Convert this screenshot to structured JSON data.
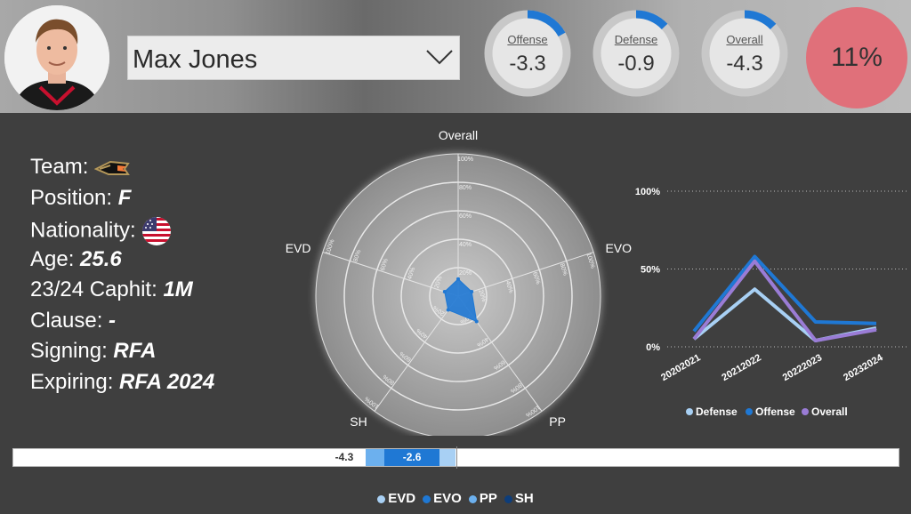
{
  "header": {
    "player_name": "Max Jones",
    "kpis": [
      {
        "label": "Offense",
        "value": "-3.3",
        "ring_fraction": 0.17
      },
      {
        "label": "Defense",
        "value": "-0.9",
        "ring_fraction": 0.13
      },
      {
        "label": "Overall",
        "value": "-4.3",
        "ring_fraction": 0.13
      }
    ],
    "percentile": "11%",
    "colors": {
      "ring_accent": "#1f78d4",
      "ring_track": "#c8c8c8",
      "percentile_bg": "#e0707a"
    }
  },
  "info": {
    "team_label": "Team:",
    "team_icon": "ducks-logo-icon",
    "position_label": "Position:",
    "position_value": "F",
    "nationality_label": "Nationality:",
    "nationality_icon": "usa-flag-icon",
    "age_label": "Age:",
    "age_value": "25.6",
    "caphit_label": "23/24 Caphit:",
    "caphit_value": "1M",
    "clause_label": "Clause:",
    "clause_value": "-",
    "signing_label": "Signing:",
    "signing_value": "RFA",
    "expiring_label": "Expiring:",
    "expiring_value": "RFA 2024"
  },
  "chart_data": [
    {
      "type": "radar",
      "axes": [
        "Overall",
        "EVO",
        "PP",
        "SH",
        "EVD"
      ],
      "ring_labels": [
        "100%",
        "80%",
        "60%",
        "40%",
        "20%"
      ],
      "values": [
        0.12,
        0.1,
        0.22,
        0.12,
        0.1
      ],
      "color": "#1f78d4"
    },
    {
      "type": "line",
      "categories": [
        "20202021",
        "20212022",
        "20222023",
        "20232024"
      ],
      "series": [
        {
          "name": "Defense",
          "values": [
            5,
            37,
            4,
            12
          ],
          "color": "#a8d0f4"
        },
        {
          "name": "Offense",
          "values": [
            10,
            58,
            16,
            15
          ],
          "color": "#1f78d4"
        },
        {
          "name": "Overall",
          "values": [
            5,
            55,
            4,
            11
          ],
          "color": "#9a7cd6"
        }
      ],
      "y_ticks": [
        "100%",
        "50%",
        "0%"
      ],
      "ylim": [
        0,
        100
      ],
      "legend_position": "bottom"
    },
    {
      "type": "bar",
      "orientation": "horizontal-stacked",
      "total_label": "-4.3",
      "segments": [
        {
          "name": "EVD",
          "value": -0.8,
          "color": "#a8d0f4"
        },
        {
          "name": "EVO",
          "value": -2.6,
          "color": "#1f78d4"
        },
        {
          "name": "PP",
          "value": -0.9,
          "color": "#6cb0ee"
        },
        {
          "name": "SH",
          "value": 0.0,
          "color": "#0d3d7a"
        }
      ],
      "segment_label": "-2.6",
      "legend": [
        "EVD",
        "EVO",
        "PP",
        "SH"
      ],
      "xlim": [
        -21,
        21
      ]
    }
  ]
}
